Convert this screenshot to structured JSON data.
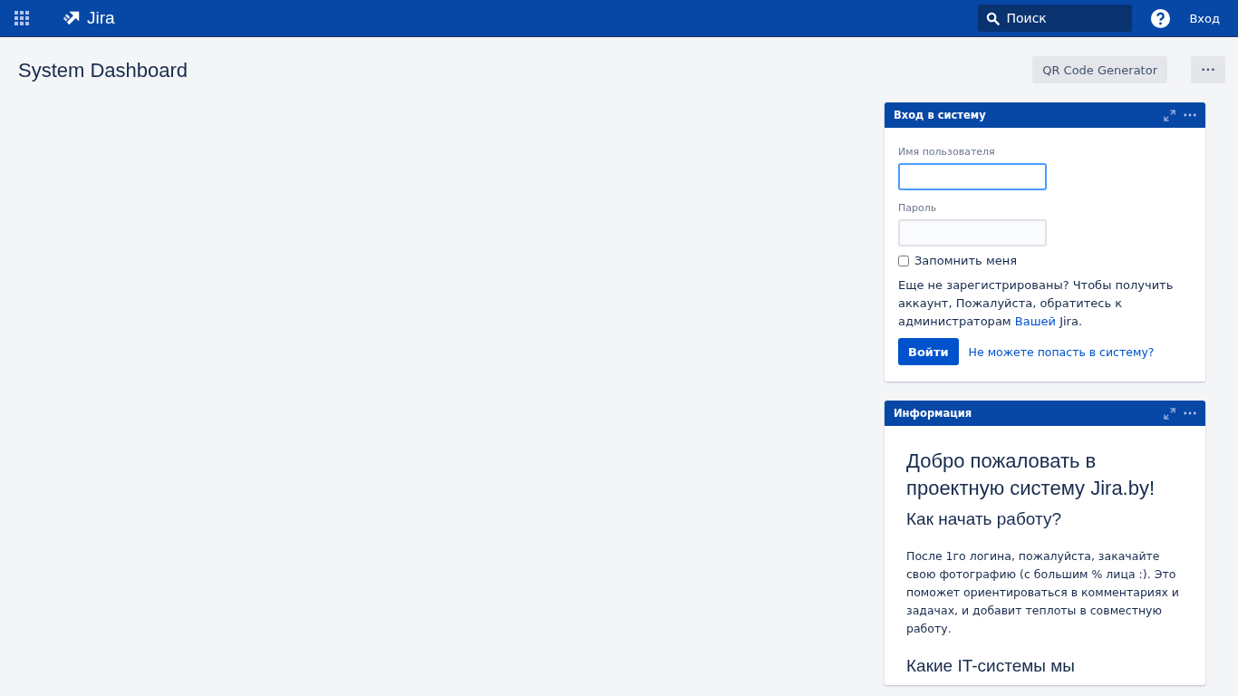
{
  "header": {
    "logo": "Jira",
    "search": {
      "placeholder": "Поиск"
    },
    "login_link": "Вход"
  },
  "page": {
    "title": "System Dashboard",
    "actions": [
      "QR Code Generator",
      "•••"
    ]
  },
  "gadgets": [
    {
      "kind": "login",
      "title": "Вход в систему",
      "username_label": "Имя пользователя",
      "password_label": "Пароль",
      "remember": {
        "label": "Запомнить меня",
        "checked": false
      },
      "note": "Еще не зарегистрированы? Чтобы получить аккаунт, Пожалуйста, обратитесь к администраторам",
      "note_link": "Вашей",
      "note_tail": "Jira.",
      "submit": "Войти",
      "help_link": "Не можете попасть в систему?"
    },
    {
      "kind": "info",
      "title": "Информация",
      "heading": "Добро пожаловать в проектную систему Jira.by!",
      "subheading": "Как начать работу?",
      "paragraph": "После 1го логина, пожалуйста, закачайте свою фотографию (с большим % лица :). Это поможет ориентироваться в комментариях и задачах, и добавит теплоты в совместную работу.",
      "subheading_2": "Какие IT-системы мы"
    }
  ]
}
